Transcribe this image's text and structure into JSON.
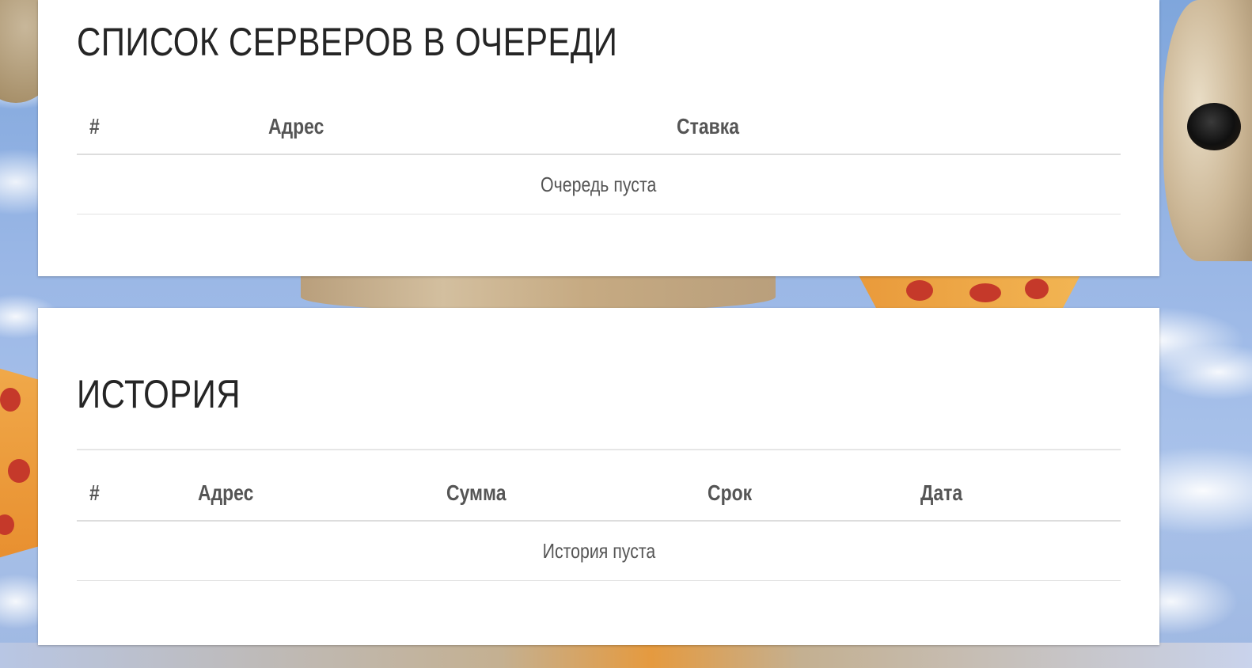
{
  "queue": {
    "title": "СПИСОК СЕРВЕРОВ В ОЧЕРЕДИ",
    "columns": [
      "#",
      "Адрес",
      "Ставка"
    ],
    "empty_message": "Очередь пуста"
  },
  "history": {
    "title": "ИСТОРИЯ",
    "columns": [
      "#",
      "Адрес",
      "Сумма",
      "Срок",
      "Дата"
    ],
    "empty_message": "История пуста"
  }
}
